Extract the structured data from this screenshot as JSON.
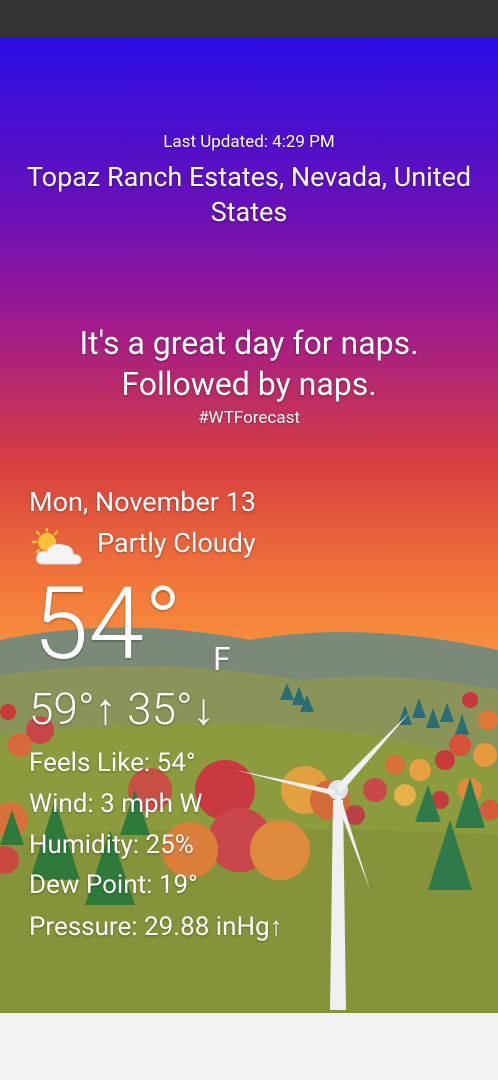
{
  "header": {
    "last_updated": "Last Updated: 4:29 PM",
    "location": "Topaz Ranch Estates, Nevada, United States"
  },
  "quip": {
    "text": "It's a great day for naps. Followed by naps.",
    "hashtag": "#WTForecast"
  },
  "current": {
    "date": "Mon, November 13",
    "condition": "Partly Cloudy",
    "condition_icon": "partly-cloudy-icon",
    "temperature": "54°",
    "unit": "F",
    "high_low": "59°↑ 35°↓"
  },
  "details": {
    "feels_like": "Feels Like:  54°",
    "wind": "Wind:  3 mph W",
    "humidity": "Humidity:  25%",
    "dew_point": "Dew Point:  19°",
    "pressure": "Pressure:  29.88 inHg↑"
  },
  "colors": {
    "sky_top": "#2a0ee6",
    "sky_mid": "#a21b8a",
    "sky_horizon": "#f7943e",
    "grass": "#8a9a3c",
    "status_bar": "#333333"
  }
}
